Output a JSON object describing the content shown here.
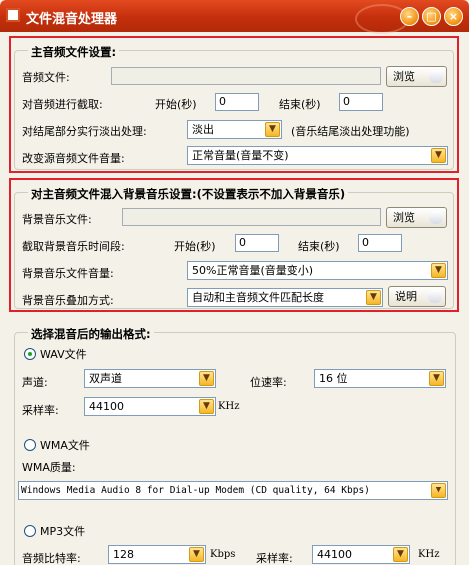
{
  "window": {
    "title": "文件混音处理器",
    "min_label": "–",
    "max_label": "□",
    "close_label": "×",
    "accent": "#c8300e"
  },
  "main_audio": {
    "title": "主音频文件设置:",
    "file_label": "音频文件:",
    "file_value": "",
    "browse_label": "浏览",
    "trim_label": "对音频进行截取:",
    "start_label": "开始(秒)",
    "start_value": "0",
    "end_label": "结束(秒)",
    "end_value": "0",
    "fade_label": "对结尾部分实行淡出处理:",
    "fade_value": "淡出",
    "fade_hint": "(音乐结尾淡出处理功能)",
    "volume_label": "改变源音频文件音量:",
    "volume_value": "正常音量(音量不变)"
  },
  "bg_music": {
    "title": "对主音频文件混入背景音乐设置:(不设置表示不加入背景音乐)",
    "file_label": "背景音乐文件:",
    "file_value": "",
    "browse_label": "浏览",
    "trim_label": "截取背景音乐时间段:",
    "start_label": "开始(秒)",
    "start_value": "0",
    "end_label": "结束(秒)",
    "end_value": "0",
    "volume_label": "背景音乐文件音量:",
    "volume_value": "50%正常音量(音量变小)",
    "mix_label": "背景音乐叠加方式:",
    "mix_value": "自动和主音频文件匹配长度",
    "explain_label": "说明"
  },
  "output": {
    "title": "选择混音后的输出格式:",
    "wav": {
      "label": "WAV文件",
      "selected": true,
      "channel_label": "声道:",
      "channel_value": "双声道",
      "bitrate_label": "位速率:",
      "bitrate_value": "16 位",
      "samplerate_label": "采样率:",
      "samplerate_value": "44100",
      "samplerate_unit": "KHz"
    },
    "wma": {
      "label": "WMA文件",
      "selected": false,
      "quality_label": "WMA质量:",
      "quality_value": "Windows Media Audio 8 for Dial-up Modem (CD quality, 64 Kbps)"
    },
    "mp3": {
      "label": "MP3文件",
      "selected": false,
      "bitrate_label": "音频比特率:",
      "bitrate_value": "128",
      "bitrate_unit": "Kbps",
      "samplerate_label": "采样率:",
      "samplerate_value": "44100",
      "samplerate_unit": "KHz"
    }
  }
}
